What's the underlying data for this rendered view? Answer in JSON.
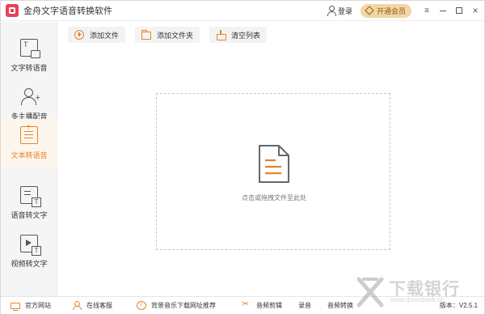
{
  "window": {
    "title": "金舟文字语音转换软件",
    "login_label": "登录",
    "vip_label": "开通会员",
    "controls": {
      "menu": "≡",
      "minimize": "",
      "maximize": "",
      "close": "×"
    }
  },
  "sidebar": {
    "items": [
      {
        "label": "文字转语音",
        "icon": "text-file-icon"
      },
      {
        "label": "多主播配音",
        "icon": "person-add-icon"
      },
      {
        "label": "文本转语音",
        "icon": "document-text-icon",
        "active": true
      },
      {
        "label": "语音转文字",
        "icon": "voice-to-text-icon"
      },
      {
        "label": "视频转文字",
        "icon": "video-to-text-icon"
      }
    ]
  },
  "toolbar": {
    "add_file": "添加文件",
    "add_folder": "添加文件夹",
    "clear_list": "清空列表"
  },
  "dropzone": {
    "hint": "点击或拖拽文件至此处"
  },
  "bottombar": {
    "website": "官方网站",
    "service": "在线客服",
    "music_link": "背景音乐下载网址推荐",
    "audio_edit": "音频剪辑",
    "record": "录音",
    "audio_convert": "音频转换",
    "version": "版本：V2.5.1"
  },
  "watermark": {
    "text": "下载银行",
    "url": "www.downbank.cn"
  },
  "colors": {
    "accent": "#e6842c",
    "vip_bg": "#f3d6a5",
    "logo": "#e8435a"
  }
}
